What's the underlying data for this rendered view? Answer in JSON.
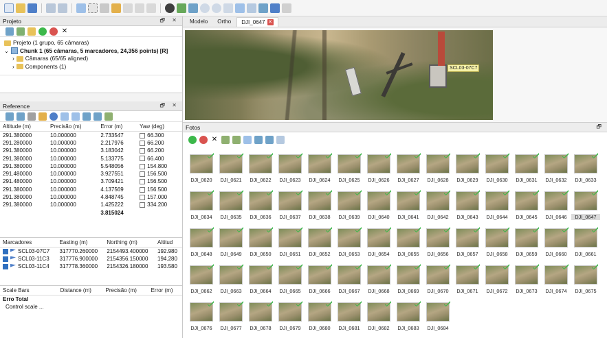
{
  "projeto": {
    "title": "Projeto",
    "controls": "🗗 ✕",
    "tree": {
      "project": "Projeto (1 grupo, 65 câmaras)",
      "chunk": "Chunk 1 (65 câmaras, 5 marcadores, 24,356 points) [R]",
      "cameras": "Câmaras (65/65 aligned)",
      "components": "Components (1)"
    }
  },
  "reference": {
    "title": "Reference",
    "controls": "🗗 ✕",
    "columns": [
      "Altitude (m)",
      "Precisão (m)",
      "Error (m)",
      "Yaw (deg)"
    ],
    "rows": [
      [
        "291.380000",
        "10.000000",
        "2.733547",
        "66.300"
      ],
      [
        "291.280000",
        "10.000000",
        "2.217976",
        "66.200"
      ],
      [
        "291.380000",
        "10.000000",
        "3.183042",
        "66.200"
      ],
      [
        "291.380000",
        "10.000000",
        "5.133775",
        "66.400"
      ],
      [
        "291.380000",
        "10.000000",
        "5.548056",
        "154.800"
      ],
      [
        "291.480000",
        "10.000000",
        "3.927551",
        "156.500"
      ],
      [
        "291.480000",
        "10.000000",
        "3.709421",
        "156.500"
      ],
      [
        "291.380000",
        "10.000000",
        "4.137569",
        "156.500"
      ],
      [
        "291.380000",
        "10.000000",
        "4.848745",
        "157.000"
      ],
      [
        "291.380000",
        "10.000000",
        "1.425222",
        "334.200"
      ]
    ],
    "total_error": "3.815024"
  },
  "marcadores": {
    "columns": [
      "Marcadores",
      "Easting (m)",
      "Northing (m)",
      "Altitud"
    ],
    "rows": [
      [
        "SCL03-07C7",
        "317770.260000",
        "2154493.400000",
        "192.980"
      ],
      [
        "SCL03-11C3",
        "317776.900000",
        "2154356.150000",
        "194.280"
      ],
      [
        "SCL03-11C4",
        "317778.360000",
        "2154326.180000",
        "193.580"
      ]
    ]
  },
  "scalebars": {
    "columns": [
      "Scale Bars",
      "Distance (m)",
      "Precisão (m)",
      "Error (m)"
    ],
    "total_label": "Erro Total",
    "control_label": "Control scale ..."
  },
  "tabs": [
    "Modelo",
    "Ortho",
    "DJI_0647"
  ],
  "viewport": {
    "marker_label": "SCL03-07C7"
  },
  "fotos": {
    "title": "Fotos",
    "selected": "DJI_0647",
    "photos": [
      "DJI_0620",
      "DJI_0621",
      "DJI_0622",
      "DJI_0623",
      "DJI_0624",
      "DJI_0625",
      "DJI_0626",
      "DJI_0627",
      "DJI_0628",
      "DJI_0629",
      "DJI_0630",
      "DJI_0631",
      "DJI_0632",
      "DJI_0633",
      "DJI_0634",
      "DJI_0635",
      "DJI_0636",
      "DJI_0637",
      "DJI_0638",
      "DJI_0639",
      "DJI_0640",
      "DJI_0641",
      "DJI_0642",
      "DJI_0643",
      "DJI_0644",
      "DJI_0645",
      "DJI_0646",
      "DJI_0647",
      "DJI_0648",
      "DJI_0649",
      "DJI_0650",
      "DJI_0651",
      "DJI_0652",
      "DJI_0653",
      "DJI_0654",
      "DJI_0655",
      "DJI_0656",
      "DJI_0657",
      "DJI_0658",
      "DJI_0659",
      "DJI_0660",
      "DJI_0661",
      "DJI_0662",
      "DJI_0663",
      "DJI_0664",
      "DJI_0665",
      "DJI_0666",
      "DJI_0667",
      "DJI_0668",
      "DJI_0669",
      "DJI_0670",
      "DJI_0671",
      "DJI_0672",
      "DJI_0673",
      "DJI_0674",
      "DJI_0675",
      "DJI_0676",
      "DJI_0677",
      "DJI_0678",
      "DJI_0679",
      "DJI_0680",
      "DJI_0681",
      "DJI_0682",
      "DJI_0683",
      "DJI_0684"
    ]
  },
  "colors": {
    "accent": "#2f6fbf",
    "check": "#3cb84a",
    "close": "#d9534f"
  }
}
